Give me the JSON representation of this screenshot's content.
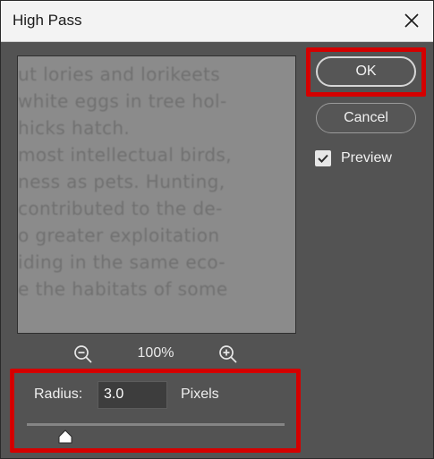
{
  "window": {
    "title": "High Pass"
  },
  "preview_text_lines": [
    "ut lories and lorikeets",
    "white eggs in tree hol-",
    "hicks hatch.",
    "most intellectual birds,",
    "ness as pets. Hunting,",
    "contributed to the de-",
    "o greater exploitation",
    "iding in the same eco-",
    "e the habitats of some"
  ],
  "zoom": {
    "level": "100%",
    "zoom_out_icon": "zoom-out-icon",
    "zoom_in_icon": "zoom-in-icon"
  },
  "buttons": {
    "ok_label": "OK",
    "cancel_label": "Cancel"
  },
  "preview_toggle": {
    "label": "Preview",
    "checked": true
  },
  "radius": {
    "label": "Radius:",
    "value": "3.0",
    "units": "Pixels",
    "slider_position": 0.15
  },
  "colors": {
    "dialog_bg": "#535353",
    "highlight": "#d40000"
  }
}
